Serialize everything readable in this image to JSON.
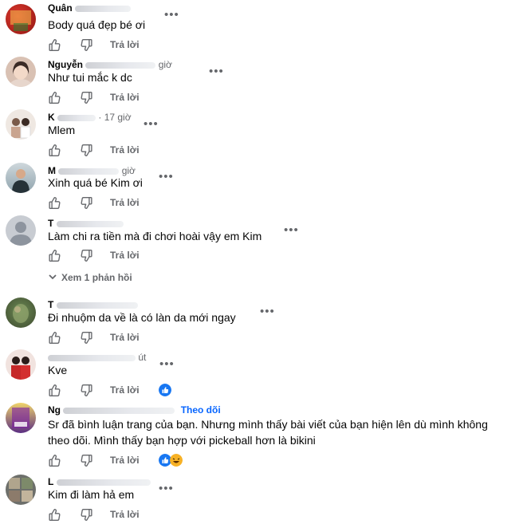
{
  "labels": {
    "reply": "Trả lời",
    "view_replies": "Xem 1 phản hồi",
    "follow": "Theo dõi"
  },
  "colors": {
    "accent": "#0866ff",
    "secondary_text": "#65676b",
    "like_reaction": "#1877f2",
    "haha_reaction": "#f7b125"
  },
  "comments": [
    {
      "name_initial": "Quân",
      "time": "",
      "text": "Body quá đẹp bé ơi",
      "avatar_icon": "red-photo-avatar"
    },
    {
      "name_initial": "Nguyễn",
      "time": "giờ",
      "text": "Như tui mắc k dc",
      "avatar_icon": "woman-photo-avatar"
    },
    {
      "name_initial": "K",
      "time": "· 17 giờ",
      "text": "Mlem",
      "avatar_icon": "couple-photo-avatar"
    },
    {
      "name_initial": "M",
      "time": "giờ",
      "text": "Xinh quá bé Kim ơi",
      "avatar_icon": "man-photo-avatar"
    },
    {
      "name_initial": "T",
      "time": "",
      "text": "Làm chi ra tiền mà đi chơi hoài vậy em Kim",
      "avatar_icon": "default-user-avatar"
    },
    {
      "name_initial": "T",
      "time": "",
      "text": "Đi nhuộm da về là có làn da mới ngay",
      "avatar_icon": "green-photo-avatar"
    },
    {
      "name_initial": "",
      "time": "út",
      "text": "Kve",
      "avatar_icon": "wedding-photo-avatar"
    },
    {
      "name_initial": "Ng",
      "time": "",
      "text_line1": "Sr đã bình luận trang của bạn. Nhưng mình thấy bài viết của bạn hiện lên dù mình không",
      "text_line2": "theo dõi. Mình thấy bạn hợp với pickeball hơn là bikini",
      "avatar_icon": "poster-photo-avatar"
    },
    {
      "name_initial": "L",
      "time": "",
      "text": "Kim đi làm hả em",
      "avatar_icon": "grid-photo-avatar"
    }
  ]
}
